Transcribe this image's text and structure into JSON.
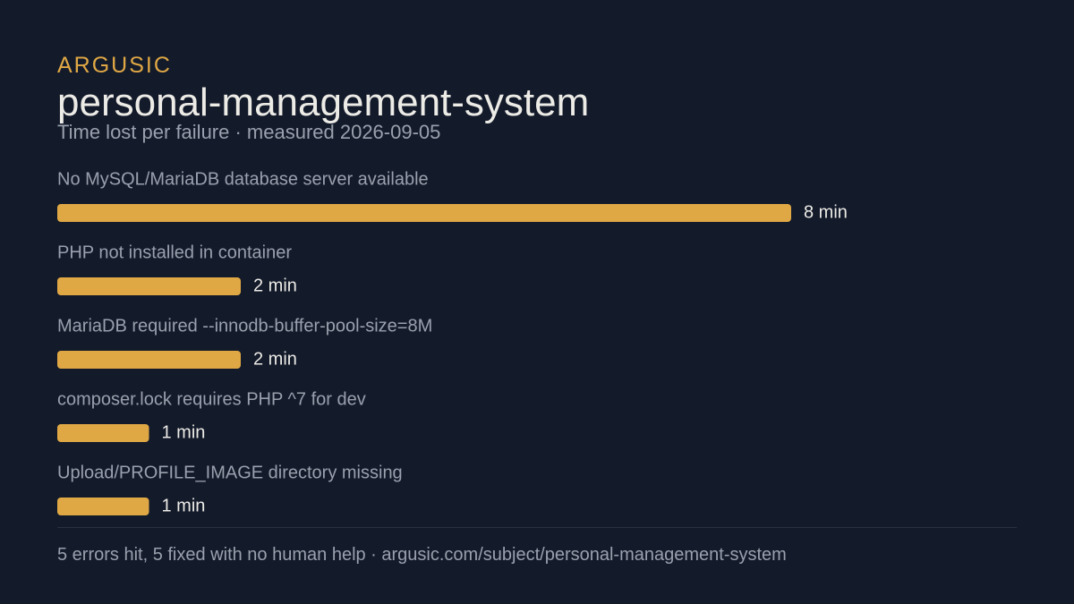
{
  "brand": "ARGUSIC",
  "header": {
    "title": "personal-management-system",
    "subtitle": "Time lost per failure · measured 2026-09-05"
  },
  "footer": {
    "text": "5 errors hit, 5 fixed with no human help · argusic.com/subject/personal-management-system"
  },
  "colors": {
    "background": "#131a2a",
    "bar": "#e0a845",
    "brand": "#e0a845",
    "label": "#9aa0ad",
    "value": "#ecebe6"
  },
  "chart_data": {
    "type": "bar",
    "orientation": "horizontal",
    "unit": "min",
    "categories": [
      "No MySQL/MariaDB database server available",
      "PHP not installed in container",
      "MariaDB required --innodb-buffer-pool-size=8M",
      "composer.lock requires PHP ^7 for dev",
      "Upload/PROFILE_IMAGE directory missing"
    ],
    "values": [
      8,
      2,
      2,
      1,
      1
    ],
    "value_labels": [
      "8 min",
      "2 min",
      "2 min",
      "1 min",
      "1 min"
    ],
    "xlim": [
      0,
      8
    ],
    "grid": false,
    "legend": "none"
  }
}
